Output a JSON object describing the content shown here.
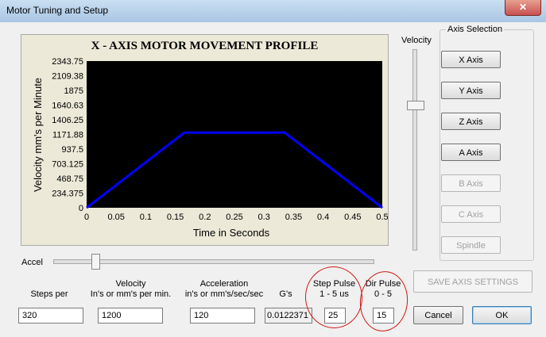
{
  "window": {
    "title": "Motor Tuning and Setup",
    "close_glyph": "✕"
  },
  "chart_data": {
    "type": "line",
    "title": "X - AXIS MOTOR MOVEMENT PROFILE",
    "xlabel": "Time in Seconds",
    "ylabel": "Velocity mm's per Minute",
    "x_ticks": [
      "0",
      "0.05",
      "0.1",
      "0.15",
      "0.2",
      "0.25",
      "0.3",
      "0.35",
      "0.4",
      "0.45",
      "0.5"
    ],
    "y_ticks": [
      "0",
      "234.375",
      "468.75",
      "703.125",
      "937.5",
      "1171.88",
      "1406.25",
      "1640.63",
      "1875",
      "2109.38",
      "2343.75"
    ],
    "xlim": [
      0,
      0.5
    ],
    "ylim": [
      0,
      2343.75
    ],
    "series": [
      {
        "x": [
          0,
          0.165,
          0.335,
          0.5
        ],
        "y": [
          0,
          1200,
          1200,
          0
        ],
        "color": "#0000ff"
      }
    ],
    "background": "#000000",
    "grid": false
  },
  "velocity_slider": {
    "label": "Velocity",
    "level": 0.73
  },
  "axis_selection": {
    "label": "Axis Selection",
    "buttons": [
      {
        "label": "X Axis",
        "enabled": true
      },
      {
        "label": "Y Axis",
        "enabled": true
      },
      {
        "label": "Z Axis",
        "enabled": true
      },
      {
        "label": "A Axis",
        "enabled": true
      },
      {
        "label": "B Axis",
        "enabled": false
      },
      {
        "label": "C Axis",
        "enabled": false
      },
      {
        "label": "Spindle",
        "enabled": false
      }
    ]
  },
  "accel_slider": {
    "label": "Accel",
    "level": 0.12
  },
  "fields": {
    "steps_per": {
      "header": "Steps per",
      "value": "320"
    },
    "velocity": {
      "header1": "Velocity",
      "header2": "In's or mm's per min.",
      "value": "1200"
    },
    "acceleration": {
      "header1": "Acceleration",
      "header2": "in's or mm's/sec/sec",
      "value": "120"
    },
    "gs": {
      "header": "G's",
      "value": "0.0122371"
    },
    "step_pulse": {
      "header1": "Step Pulse",
      "header2": "1 - 5 us",
      "value": "25"
    },
    "dir_pulse": {
      "header1": "Dir Pulse",
      "header2": "0 - 5",
      "value": "15"
    }
  },
  "buttons": {
    "save": "SAVE AXIS SETTINGS",
    "cancel": "Cancel",
    "ok": "OK"
  }
}
